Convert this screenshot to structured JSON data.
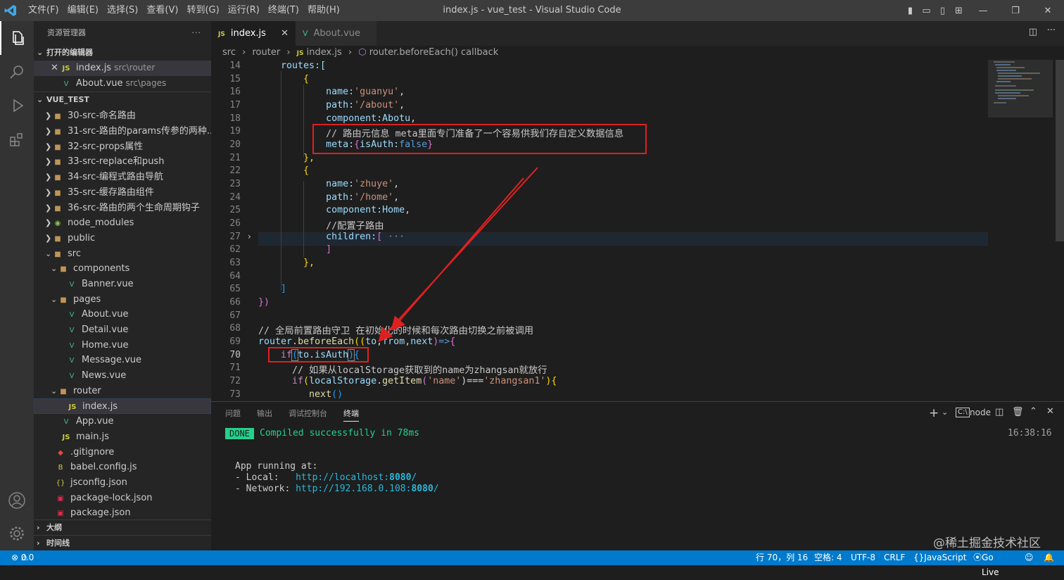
{
  "window": {
    "title": "index.js - vue_test - Visual Studio Code"
  },
  "menu": [
    "文件(F)",
    "编辑(E)",
    "选择(S)",
    "查看(V)",
    "转到(G)",
    "运行(R)",
    "终端(T)",
    "帮助(H)"
  ],
  "sidebar": {
    "header": "资源管理器",
    "open_editors_label": "打开的编辑器",
    "open_editors": [
      {
        "name": "index.js",
        "path": "src\\router"
      },
      {
        "name": "About.vue",
        "path": "src\\pages"
      }
    ],
    "project_label": "VUE_TEST",
    "tree": [
      {
        "label": "30-src-命名路由"
      },
      {
        "label": "31-src-路由的params传参的两种..."
      },
      {
        "label": "32-src-props属性"
      },
      {
        "label": "33-src-replace和push"
      },
      {
        "label": "34-src-编程式路由导航"
      },
      {
        "label": "35-src-缓存路由组件"
      },
      {
        "label": "36-src-路由的两个生命周期钩子"
      },
      {
        "label": "node_modules"
      },
      {
        "label": "public"
      },
      {
        "label": "src"
      },
      {
        "label": "components"
      },
      {
        "label": "Banner.vue"
      },
      {
        "label": "pages"
      },
      {
        "label": "About.vue"
      },
      {
        "label": "Detail.vue"
      },
      {
        "label": "Home.vue"
      },
      {
        "label": "Message.vue"
      },
      {
        "label": "News.vue"
      },
      {
        "label": "router"
      },
      {
        "label": "index.js"
      },
      {
        "label": "App.vue"
      },
      {
        "label": "main.js"
      },
      {
        "label": ".gitignore"
      },
      {
        "label": "babel.config.js"
      },
      {
        "label": "jsconfig.json"
      },
      {
        "label": "package-lock.json"
      },
      {
        "label": "package.json"
      }
    ],
    "outline_label": "大纲",
    "timeline_label": "时间线"
  },
  "tabs": [
    {
      "label": "index.js",
      "icon": "JS"
    },
    {
      "label": "About.vue",
      "icon": "V"
    }
  ],
  "breadcrumb": {
    "p1": "src",
    "p2": "router",
    "p3": "index.js",
    "p4": "router.beforeEach() callback"
  },
  "editor": {
    "lines": [
      "14",
      "15",
      "16",
      "17",
      "18",
      "19",
      "20",
      "21",
      "22",
      "23",
      "24",
      "25",
      "26",
      "27",
      "62",
      "63",
      "64",
      "65",
      "66",
      "67",
      "68",
      "69",
      "70",
      "71",
      "72",
      "73"
    ],
    "code": {
      "l14": "    routes:[",
      "l15": "        {",
      "l16a": "            name:",
      "l16b": "'guanyu'",
      "l16c": ",",
      "l17a": "            path:",
      "l17b": "'/about'",
      "l17c": ",",
      "l18a": "            component:",
      "l18b": "Abotu",
      "l18c": ",",
      "l19": "            // 路由元信息 meta里面专门准备了一个容易供我们存自定义数据信息",
      "l20a": "            meta:",
      "l20b": "{",
      "l20c": "isAuth:",
      "l20d": "false",
      "l20e": "}",
      "l21": "        },",
      "l22": "        {",
      "l23a": "            name:",
      "l23b": "'zhuye'",
      "l23c": ",",
      "l24a": "            path:",
      "l24b": "'/home'",
      "l24c": ",",
      "l25a": "            component:",
      "l25b": "Home",
      "l25c": ",",
      "l26": "            //配置子路由",
      "l27a": "            children:",
      "l27b": "[",
      "l27c": " ···",
      "l62": "            ]",
      "l63": "        },",
      "l64": "",
      "l65": "    ]",
      "l66": "})",
      "l67": "",
      "l68": "// 全局前置路由守卫 在初始化的时候和每次路由切换之前被调用",
      "l69a": "router",
      "l69b": ".",
      "l69c": "beforeEach",
      "l69d": "((",
      "l69e": "to",
      "l69f": ",",
      "l69g": "from",
      "l69h": ",",
      "l69i": "next",
      "l69j": ")",
      "l69k": "=>",
      "l69l": "{",
      "l70a": "    if",
      "l70b": "(",
      "l70c": "to",
      "l70d": ".",
      "l70e": "isAuth",
      "l70f": ")",
      "l70g": "{",
      "l71": "      // 如果从localStorage获取到的name为zhangsan就放行",
      "l72a": "      if",
      "l72b": "(",
      "l72c": "localStorage",
      "l72d": ".",
      "l72e": "getItem",
      "l72f": "(",
      "l72g": "'name'",
      "l72h": ")===",
      "l72i": "'zhangsan1'",
      "l72j": "){",
      "l73a": "         next",
      "l73b": "()"
    }
  },
  "panel": {
    "tabs": [
      "问题",
      "输出",
      "调试控制台",
      "终端"
    ],
    "shell": "node",
    "done_badge": "DONE",
    "compiled": "Compiled successfully in 78ms",
    "time": "16:38:16",
    "running": "App running at:",
    "local_label": "- Local:   ",
    "local_url_a": "http://localhost:",
    "local_url_b": "8080",
    "local_url_c": "/",
    "network_label": "- Network: ",
    "network_url_a": "http://192.168.0.108:",
    "network_url_b": "8080",
    "network_url_c": "/"
  },
  "status": {
    "errors": "0",
    "warnings": "0",
    "position": "行 70，列 16",
    "spaces": "空格: 4",
    "encoding": "UTF-8",
    "eol": "CRLF",
    "language": "JavaScript",
    "golive": "Go Live"
  },
  "watermark": "@稀土掘金技术社区",
  "colors": {
    "statusbar": "#007acc",
    "annotation": "#e02020",
    "keyword": "#569cd6",
    "string": "#ce9178",
    "comment": "#6a9955"
  }
}
